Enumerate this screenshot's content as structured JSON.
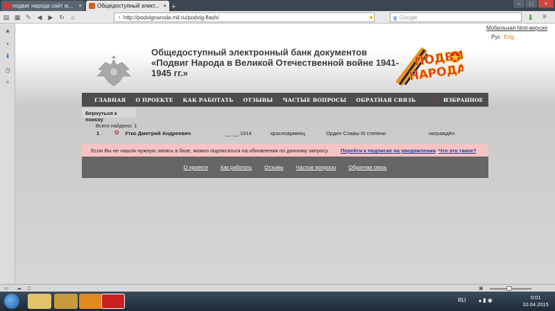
{
  "browser": {
    "tabs": [
      {
        "title": "подвиг народа сайт м...",
        "icon": "yandex-icon"
      },
      {
        "title": "Общедоступный элект...",
        "icon": "podvig-favicon"
      }
    ],
    "url": "http://podvignaroda.mil.ru/podvig-flash/",
    "search_placeholder": "Google"
  },
  "page": {
    "mobile_link": "Мобильная html-версия",
    "lang_ru": "Рус",
    "lang_en": "Eng",
    "title": "Общедоступный электронный банк документов «Подвиг Народа в Великой Отечественной войне 1941-1945 гг.»",
    "logo_text": "Подвиг Народа",
    "nav": [
      "ГЛАВНАЯ",
      "О ПРОЕКТЕ",
      "КАК РАБОТАТЬ",
      "ОТЗЫВЫ",
      "ЧАСТЫЕ ВОПРОСЫ",
      "ОБРАТНАЯ СВЯЗЬ"
    ],
    "favorites": "ИЗБРАННОЕ",
    "back": "Вернуться к поиску",
    "found": "Всего найдено: 1",
    "result": {
      "num": "1",
      "name": "Утко Дмитрий Андреевич",
      "dob": "__.__.1914",
      "rank": "красноармеец",
      "award": "Орден Славы III степени",
      "status": "награждён"
    },
    "notice": {
      "text": "Если Вы не нашли нужную запись в базе, можно подписаться на обновления по данному запросу.",
      "subscribe": "Перейти к подписке на уведомления",
      "what": "Что это такое?"
    },
    "footer": [
      "О проекте",
      "Как работать",
      "Отзывы",
      "Частые вопросы",
      "Обратная связь"
    ]
  },
  "taskbar": {
    "lang": "RU",
    "time": "0:01",
    "date": "10.04.2015"
  },
  "colors": {
    "nav_bg": "#4d4d4d",
    "notice_bg": "#f6c3c3",
    "footer_bg": "#666666",
    "link": "#1d3fa8",
    "accent": "#e07a10"
  }
}
